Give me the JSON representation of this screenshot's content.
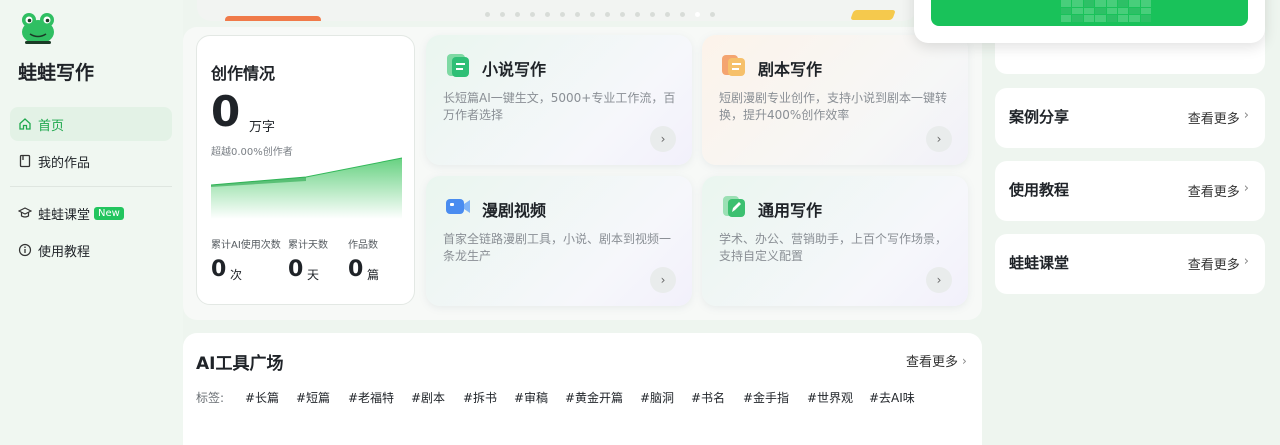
{
  "sidebar": {
    "brand": "蛙蛙写作",
    "items": [
      {
        "label": "首页"
      },
      {
        "label": "我的作品"
      },
      {
        "label": "蛙蛙课堂",
        "badge": "New"
      },
      {
        "label": "使用教程"
      }
    ]
  },
  "stats": {
    "title": "创作情况",
    "total_value": "0",
    "total_unit": "万字",
    "subtitle": "超越0.00%创作者",
    "items": [
      {
        "label": "累计AI使用次数",
        "value": "0",
        "unit": "次"
      },
      {
        "label": "累计天数",
        "value": "0",
        "unit": "天"
      },
      {
        "label": "作品数",
        "value": "0",
        "unit": "篇"
      }
    ]
  },
  "features": [
    {
      "title": "小说写作",
      "desc": "长短篇AI一键生文，5000+专业工作流，百万作者选择"
    },
    {
      "title": "剧本写作",
      "desc": "短剧漫剧专业创作，支持小说到剧本一键转换，提升400%创作效率"
    },
    {
      "title": "漫剧视频",
      "desc": "首家全链路漫剧工具，小说、剧本到视频一条龙生产"
    },
    {
      "title": "通用写作",
      "desc": "学术、办公、营销助手，上百个写作场景，支持自定义配置"
    }
  ],
  "tools": {
    "title": "AI工具广场",
    "more": "查看更多",
    "tag_label": "标签:",
    "tags": [
      "#长篇",
      "#短篇",
      "#老福特",
      "#剧本",
      "#拆书",
      "#审稿",
      "#黄金开篇",
      "#脑洞",
      "#书名",
      "#金手指",
      "#世界观",
      "#去AI味"
    ]
  },
  "right": {
    "cards": [
      {
        "title": "案例分享",
        "more": "查看更多"
      },
      {
        "title": "使用教程",
        "more": "查看更多"
      },
      {
        "title": "蛙蛙课堂",
        "more": "查看更多"
      }
    ]
  },
  "colors": {
    "accent": "#22c55e",
    "active_text": "#1fa84d",
    "background": "#eef5ef"
  }
}
